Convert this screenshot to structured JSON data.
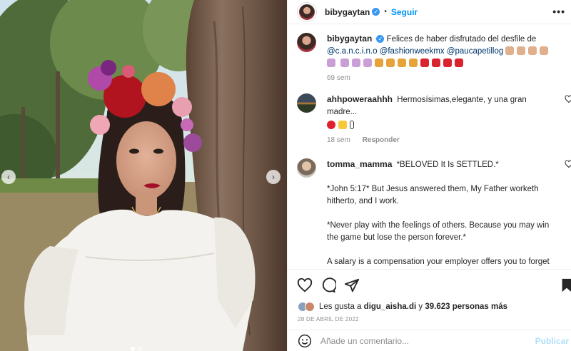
{
  "post": {
    "username": "bibygaytan",
    "follow_label": "Seguir",
    "more_label": "•••"
  },
  "caption": {
    "username": "bibygaytan",
    "text": "Felices de haber disfrutado del desfile de",
    "mentions": [
      "@c.a.n.c.i.n.o",
      "@fashionweekmx",
      "@paucapetillog"
    ],
    "time": "69 sem"
  },
  "comments": [
    {
      "username": "ahhpoweraahhh",
      "text": "Hermosísimas,elegante, y una gran madre...",
      "time": "18 sem",
      "reply_label": "Responder"
    },
    {
      "username": "tomma_mamma",
      "text": "*BELOVED It Is SETTLED.*",
      "paragraphs": [
        "*John 5:17* But Jesus answered them, My Father worketh hitherto, and I work.",
        "*Never play with the feelings of others. Because you may win the game but lose the person forever.*",
        "A salary is a compensation your employer offers you to forget about slavery."
      ]
    }
  ],
  "likes": {
    "prefix": "Les gusta a",
    "user": "digu_aisha.di",
    "conjunction": "y",
    "count_text": "39.623 personas más"
  },
  "date": "28 DE ABRIL DE 2022",
  "add_comment": {
    "placeholder": "Añade un comentario...",
    "publish_label": "Publicar"
  },
  "icons": {
    "verified": "verified-badge-icon",
    "like": "heart-icon",
    "comment": "comment-bubble-icon",
    "share": "paper-plane-icon",
    "save": "bookmark-icon",
    "emoji": "emoji-icon"
  },
  "colors": {
    "link_blue": "#0095f6",
    "mention_blue": "#00376b",
    "muted": "#8e8e8e"
  }
}
